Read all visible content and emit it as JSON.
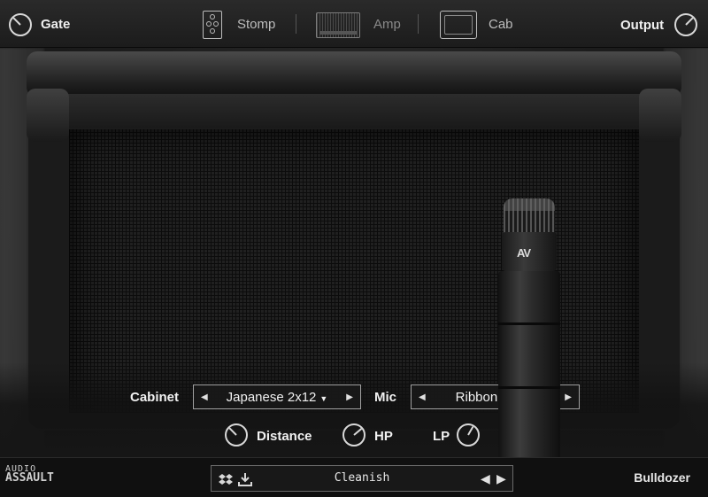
{
  "header": {
    "gate_label": "Gate",
    "output_label": "Output",
    "tabs": [
      {
        "label": "Stomp",
        "icon": "stomp-pedal-icon",
        "active": false
      },
      {
        "label": "Amp",
        "icon": "amp-head-icon",
        "active": true
      },
      {
        "label": "Cab",
        "icon": "cabinet-icon",
        "active": false
      }
    ]
  },
  "cab_controls": {
    "cabinet_label": "Cabinet",
    "cabinet_value": "Japanese 2x12",
    "mic_label": "Mic",
    "mic_value": "Ribbon 121",
    "distance_label": "Distance",
    "hp_label": "HP",
    "lp_label": "LP",
    "mic_logo": "AV"
  },
  "footer": {
    "brand_line1": "AUDIO",
    "brand_line2": "ASSAULT",
    "preset_name": "Cleanish",
    "product_name": "Bulldozer",
    "icons": [
      "dropbox-icon",
      "download-icon",
      "prev-arrow-icon",
      "next-arrow-icon"
    ]
  },
  "colors": {
    "background": "#0d0d0d",
    "text": "#f0f0f0",
    "tab_dim": "#8a8a8a",
    "border": "#a0a0a0"
  }
}
